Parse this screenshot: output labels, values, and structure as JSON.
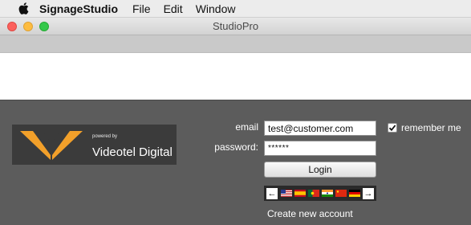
{
  "menubar": {
    "apple_icon": "apple-logo-icon",
    "app_name": "SignageStudio",
    "items": [
      "File",
      "Edit",
      "Window"
    ]
  },
  "window": {
    "title": "StudioPro"
  },
  "brand": {
    "powered_by": "powered by",
    "company": "Videotel Digital",
    "logo_color": "#f2a02a"
  },
  "login": {
    "email_label": "email",
    "email_value": "test@customer.com",
    "password_label": "password:",
    "password_value": "******",
    "login_button": "Login",
    "remember_me_label": "remember me",
    "remember_me_checked": true,
    "create_account": "Create new account"
  },
  "languages": {
    "prev_icon": "arrow-left-icon",
    "next_icon": "arrow-right-icon",
    "flags": [
      "us-flag-icon",
      "spain-flag-icon",
      "portugal-flag-icon",
      "india-flag-icon",
      "china-flag-icon",
      "germany-flag-icon"
    ]
  },
  "colors": {
    "panel_bg": "#5c5c5c",
    "logo_bg": "#3b3b3b",
    "close": "#fc605c",
    "minimize": "#fdbc40",
    "maximize": "#34c84a"
  }
}
